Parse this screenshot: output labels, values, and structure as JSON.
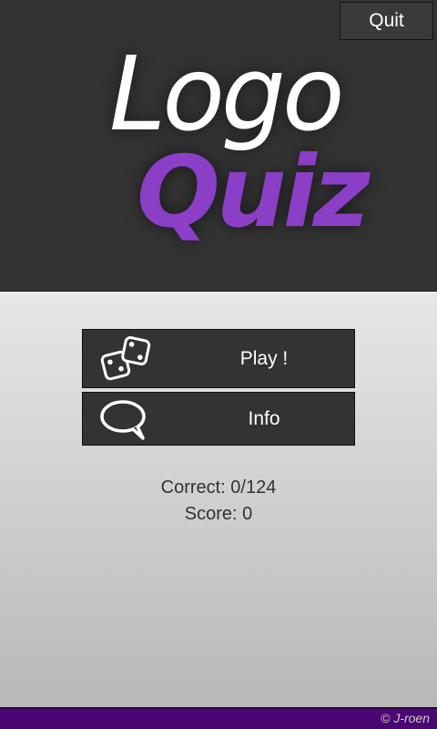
{
  "header": {
    "quit_label": "Quit",
    "logo_line1": "Logo",
    "logo_line2": "Quiz"
  },
  "menu": {
    "play": {
      "label": "Play !",
      "icon": "dice-icon"
    },
    "info": {
      "label": "Info",
      "icon": "speech-bubble-icon"
    }
  },
  "stats": {
    "correct": "Correct: 0/124",
    "score": "Score: 0"
  },
  "footer": {
    "copyright": "© J-roen"
  },
  "colors": {
    "header_bg": "#333333",
    "accent_purple": "#8a3fc6",
    "footer_purple": "#4a0672"
  }
}
